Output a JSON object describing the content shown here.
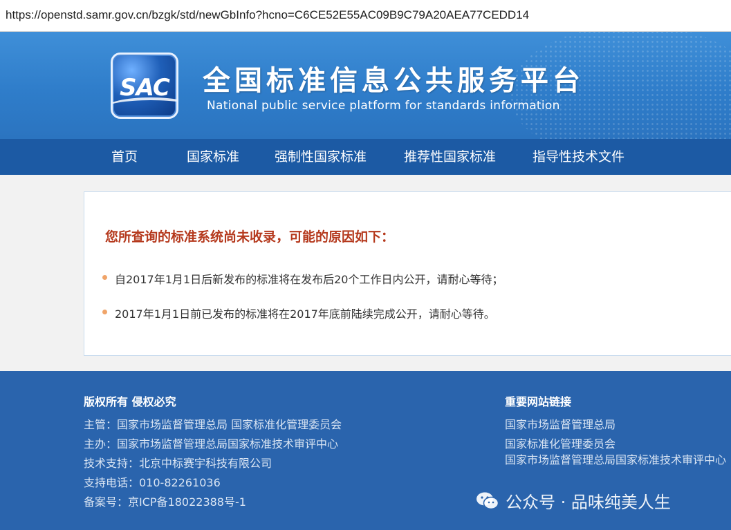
{
  "browser": {
    "url": "https://openstd.samr.gov.cn/bzgk/std/newGbInfo?hcno=C6CE52E55AC09B9C79A20AEA77CEDD14"
  },
  "header": {
    "logo_text": "SAC",
    "title": "全国标准信息公共服务平台",
    "subtitle": "National public service platform  for standards information"
  },
  "nav": {
    "items": [
      "首页",
      "国家标准",
      "强制性国家标准",
      "推荐性国家标准",
      "指导性技术文件"
    ]
  },
  "notice": {
    "title": "您所查询的标准系统尚未收录，可能的原因如下：",
    "reasons": [
      "自2017年1月1日后新发布的标准将在发布后20个工作日内公开，请耐心等待；",
      "2017年1月1日前已发布的标准将在2017年底前陆续完成公开，请耐心等待。"
    ]
  },
  "footer": {
    "copyright": "版权所有 侵权必究",
    "lines": [
      "主管：国家市场监督管理总局 国家标准化管理委员会",
      "主办：国家市场监督管理总局国家标准技术审评中心",
      "技术支持：北京中标赛宇科技有限公司",
      "支持电话：010-82261036",
      "备案号：京ICP备18022388号-1"
    ],
    "links_title": "重要网站链接",
    "links": [
      "国家市场监督管理总局",
      "国家标准化管理委员会",
      "国家市场监督管理总局国家标准技术审评中心"
    ]
  },
  "watermark": {
    "text": "公众号 · 品味纯美人生"
  },
  "colors": {
    "banner": "#2f7dca",
    "nav": "#1c5aa4",
    "footer": "#2a64ad",
    "notice_title": "#b5391d",
    "bullet": "#f0a469"
  }
}
